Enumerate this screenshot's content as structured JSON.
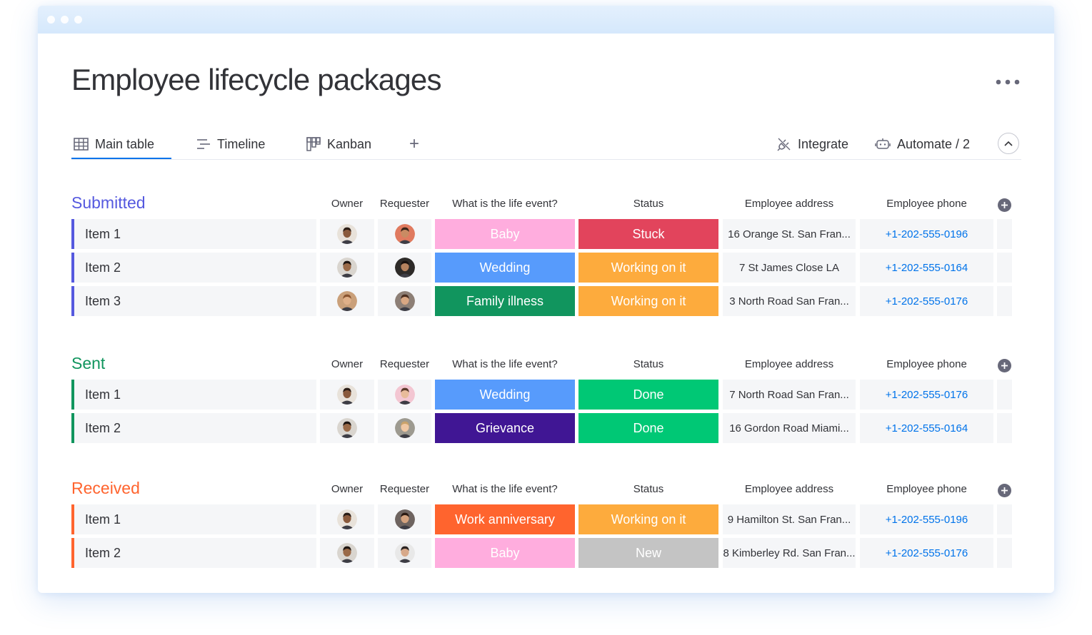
{
  "page": {
    "title": "Employee lifecycle packages"
  },
  "tabs": {
    "main_table": "Main table",
    "timeline": "Timeline",
    "kanban": "Kanban",
    "add": "+",
    "integrate": "Integrate",
    "automate": "Automate / 2"
  },
  "columns": {
    "owner": "Owner",
    "requester": "Requester",
    "event": "What is the life event?",
    "status": "Status",
    "address": "Employee address",
    "phone": "Employee phone"
  },
  "colors": {
    "submitted": "#5559df",
    "sent": "#037f4c",
    "received": "#ff642e",
    "baby": "#ffadad",
    "wedding": "#579bfc",
    "family_illness": "#037f4c",
    "grievance": "#401694",
    "work_anniversary": "#ff642e",
    "stuck": "#e2445c",
    "working": "#fdab3d",
    "done": "#00c875",
    "new": "#c4c4c4"
  },
  "groups": [
    {
      "title": "Submitted",
      "color": "#5559df",
      "rows": [
        {
          "name": "Item 1",
          "event": "Baby",
          "event_color": "#ffadde",
          "status": "Stuck",
          "status_color": "#e2445c",
          "address": "16 Orange St. San Fran...",
          "phone": "+1-202-555-0196",
          "owner_avatar": "man-dark",
          "requester_avatar": "man-beard"
        },
        {
          "name": "Item 2",
          "event": "Wedding",
          "event_color": "#579bfc",
          "status": "Working on it",
          "status_color": "#fdab3d",
          "address": "7 St James Close LA",
          "phone": "+1-202-555-0164",
          "owner_avatar": "woman-dark",
          "requester_avatar": "man-smile"
        },
        {
          "name": "Item 3",
          "event": "Family illness",
          "event_color": "#11955e",
          "status": "Working on it",
          "status_color": "#fdab3d",
          "address": "3 North Road San Fran...",
          "phone": "+1-202-555-0176",
          "owner_avatar": "woman-curly",
          "requester_avatar": "woman-brown"
        }
      ]
    },
    {
      "title": "Sent",
      "color": "#11955e",
      "rows": [
        {
          "name": "Item 1",
          "event": "Wedding",
          "event_color": "#579bfc",
          "status": "Done",
          "status_color": "#00c875",
          "address": "7 North Road San Fran...",
          "phone": "+1-202-555-0176",
          "owner_avatar": "man-dark",
          "requester_avatar": "woman-pink"
        },
        {
          "name": "Item 2",
          "event": "Grievance",
          "event_color": "#401694",
          "status": "Done",
          "status_color": "#00c875",
          "address": "16 Gordon Road Miami...",
          "phone": "+1-202-555-0164",
          "owner_avatar": "woman-dark",
          "requester_avatar": "woman-blonde"
        }
      ]
    },
    {
      "title": "Received",
      "color": "#ff642e",
      "rows": [
        {
          "name": "Item 1",
          "event": "Work anniversary",
          "event_color": "#ff642e",
          "status": "Working on it",
          "status_color": "#fdab3d",
          "address": "9 Hamilton St. San Fran...",
          "phone": "+1-202-555-0196",
          "owner_avatar": "man-dark",
          "requester_avatar": "woman-long"
        },
        {
          "name": "Item 2",
          "event": "Baby",
          "event_color": "#ffadde",
          "status": "New",
          "status_color": "#c4c4c4",
          "address": "8 Kimberley Rd. San Fran...",
          "phone": "+1-202-555-0176",
          "owner_avatar": "woman-dark",
          "requester_avatar": "man-glasses"
        }
      ]
    }
  ]
}
